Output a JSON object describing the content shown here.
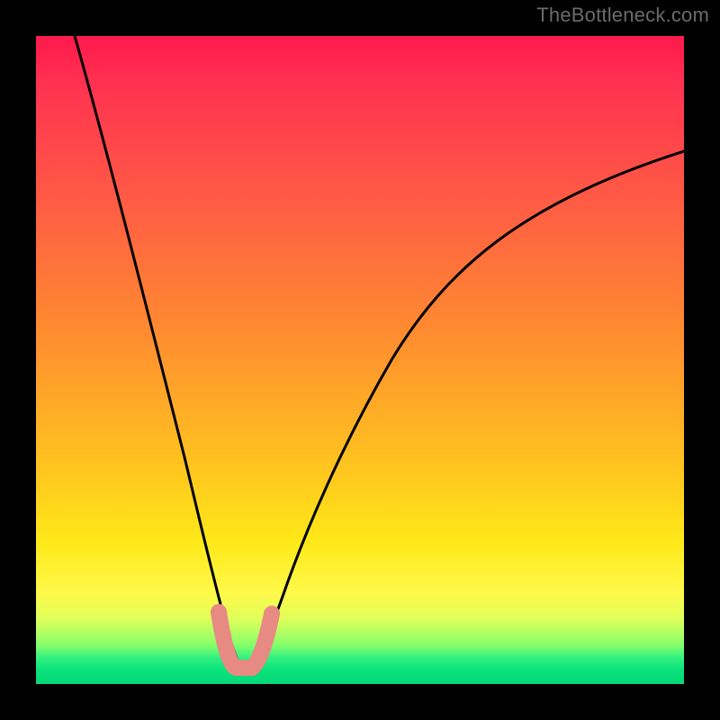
{
  "watermark": "TheBottleneck.com",
  "chart_data": {
    "type": "line",
    "title": "",
    "xlabel": "",
    "ylabel": "",
    "xlim": [
      0,
      100
    ],
    "ylim": [
      0,
      100
    ],
    "series": [
      {
        "name": "bottleneck-curve",
        "x": [
          6,
          10,
          15,
          20,
          23,
          25,
          27,
          29,
          30.5,
          31.5,
          33,
          35,
          38,
          42,
          48,
          55,
          63,
          72,
          82,
          92,
          100
        ],
        "values": [
          100,
          84,
          65,
          45,
          32,
          22,
          13,
          6,
          2,
          1.5,
          2,
          6,
          14,
          24,
          37,
          49,
          59,
          67,
          74,
          79,
          82
        ]
      },
      {
        "name": "highlight-band",
        "x": [
          28.5,
          29.5,
          30.5,
          31.5,
          32.5,
          33.5,
          34.5
        ],
        "values": [
          7.5,
          4,
          2,
          1.8,
          2.2,
          4.5,
          8
        ]
      }
    ],
    "annotations": []
  }
}
